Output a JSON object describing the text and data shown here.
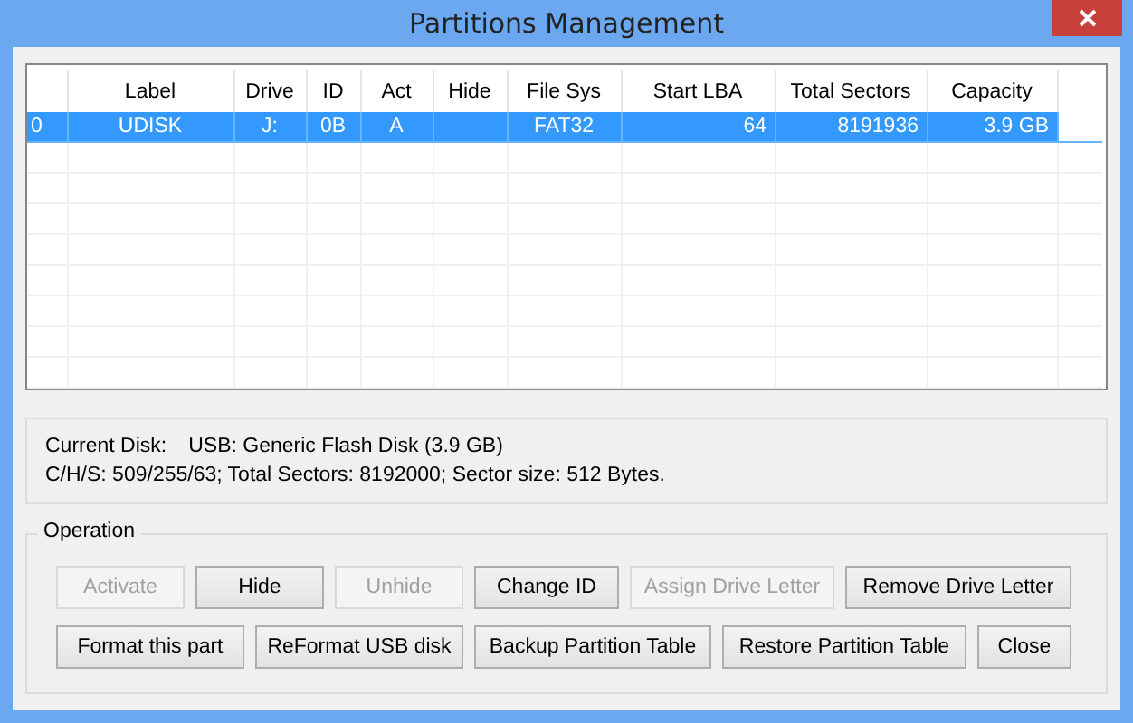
{
  "window": {
    "title": "Partitions Management"
  },
  "table": {
    "columns": [
      "Label",
      "Drive",
      "ID",
      "Act",
      "Hide",
      "File Sys",
      "Start LBA",
      "Total Sectors",
      "Capacity"
    ],
    "rows": [
      {
        "number": "0",
        "selected": true,
        "cells": [
          "UDISK",
          "J:",
          "0B",
          "A",
          "",
          "FAT32",
          "64",
          "8191936",
          "3.9 GB"
        ]
      }
    ]
  },
  "disk_info": {
    "label": "Current Disk:",
    "value": "USB: Generic Flash Disk (3.9 GB)",
    "details": "C/H/S: 509/255/63; Total Sectors: 8192000; Sector size: 512 Bytes."
  },
  "operation": {
    "title": "Operation",
    "button_rows": [
      [
        {
          "label": "Activate",
          "disabled": true
        },
        {
          "label": "Hide",
          "disabled": false
        },
        {
          "label": "Unhide",
          "disabled": true
        },
        {
          "label": "Change ID",
          "disabled": false
        },
        {
          "label": "Assign Drive Letter",
          "disabled": true
        },
        {
          "label": "Remove Drive Letter",
          "disabled": false
        }
      ],
      [
        {
          "label": "Format this part",
          "disabled": false
        },
        {
          "label": "ReFormat USB disk",
          "disabled": false
        },
        {
          "label": "Backup Partition Table",
          "disabled": false
        },
        {
          "label": "Restore Partition Table",
          "disabled": false
        },
        {
          "label": "Close",
          "disabled": false
        }
      ]
    ]
  }
}
